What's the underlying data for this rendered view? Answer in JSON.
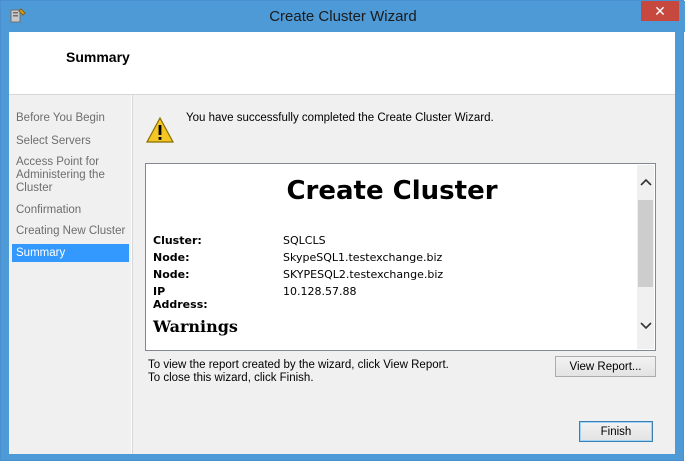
{
  "window": {
    "title": "Create Cluster Wizard",
    "close_glyph": "✕"
  },
  "header": {
    "title": "Summary"
  },
  "nav": {
    "items": [
      {
        "label": "Before You Begin",
        "active": false
      },
      {
        "label": "Select Servers",
        "active": false
      },
      {
        "label": "Access Point for Administering the Cluster",
        "active": false
      },
      {
        "label": "Confirmation",
        "active": false
      },
      {
        "label": "Creating New Cluster",
        "active": false
      },
      {
        "label": "Summary",
        "active": true
      }
    ]
  },
  "main": {
    "success_message": "You have successfully completed the Create Cluster Wizard.",
    "report": {
      "heading": "Create Cluster",
      "rows": [
        {
          "key": "Cluster:",
          "value": "SQLCLS"
        },
        {
          "key": "Node:",
          "value": "SkypeSQL1.testexchange.biz"
        },
        {
          "key": "Node:",
          "value": "SKYPESQL2.testexchange.biz"
        },
        {
          "key": "IP Address:",
          "value": "10.128.57.88"
        }
      ],
      "warnings_heading": "Warnings"
    },
    "hint_view_report": "To view the report created by the wizard, click View Report.",
    "hint_finish": "To close this wizard, click Finish.",
    "view_report_label": "View Report...",
    "finish_label": "Finish"
  },
  "icons": {
    "app": "cluster-wizard-icon",
    "warning": "warning-icon",
    "scroll_up": "chevron-up-icon",
    "scroll_down": "chevron-down-icon"
  },
  "colors": {
    "titlebar": "#4e9ad6",
    "close": "#c7483e",
    "selected": "#3399ff"
  }
}
